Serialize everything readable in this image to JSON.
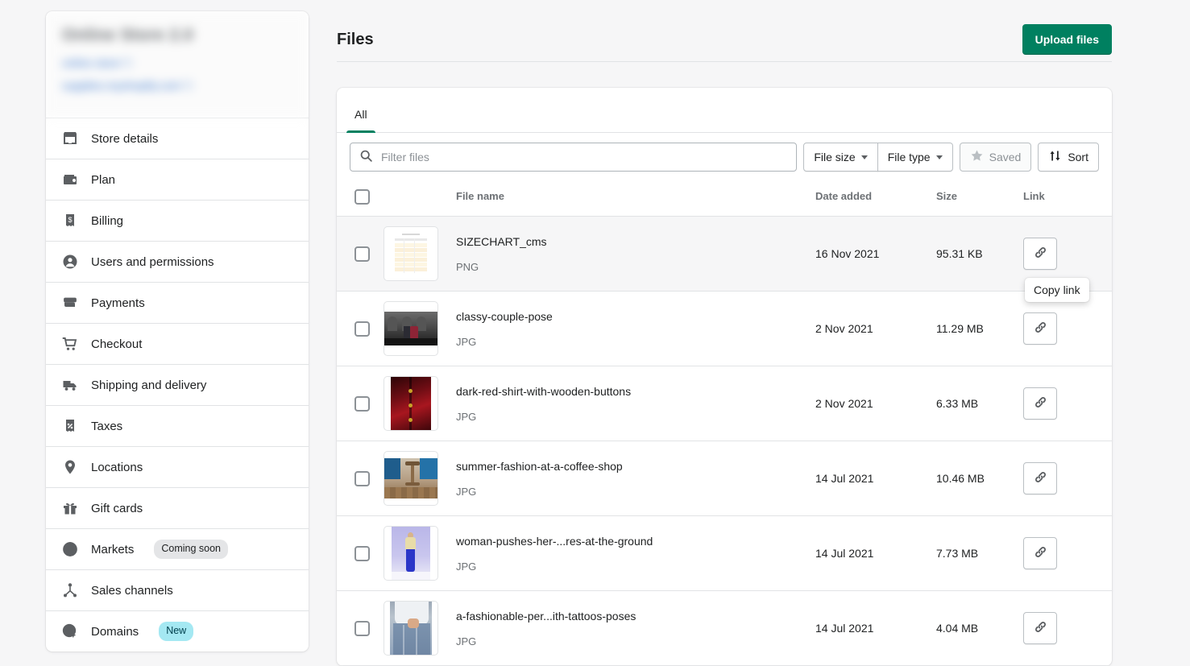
{
  "sidebar": {
    "store": {
      "name": "Online Store 2.0",
      "link_primary": "online store",
      "link_secondary": "supplies.myshopify.com"
    },
    "items": [
      {
        "label": "Store details",
        "icon": "storefront-icon",
        "badge": null
      },
      {
        "label": "Plan",
        "icon": "wallet-icon",
        "badge": null
      },
      {
        "label": "Billing",
        "icon": "receipt-dollar-icon",
        "badge": null
      },
      {
        "label": "Users and permissions",
        "icon": "person-circle-icon",
        "badge": null
      },
      {
        "label": "Payments",
        "icon": "credit-card-icon",
        "badge": null
      },
      {
        "label": "Checkout",
        "icon": "shopping-cart-icon",
        "badge": null
      },
      {
        "label": "Shipping and delivery",
        "icon": "delivery-truck-icon",
        "badge": null
      },
      {
        "label": "Taxes",
        "icon": "receipt-percent-icon",
        "badge": null
      },
      {
        "label": "Locations",
        "icon": "map-pin-icon",
        "badge": null
      },
      {
        "label": "Gift cards",
        "icon": "gift-icon",
        "badge": null
      },
      {
        "label": "Markets",
        "icon": "globe-icon",
        "badge": "Coming soon",
        "badge_style": "coming"
      },
      {
        "label": "Sales channels",
        "icon": "channels-icon",
        "badge": null
      },
      {
        "label": "Domains",
        "icon": "globe-cursor-icon",
        "badge": "New",
        "badge_style": "new"
      }
    ]
  },
  "header": {
    "title": "Files",
    "upload_label": "Upload files"
  },
  "tabs": [
    {
      "label": "All",
      "active": true
    }
  ],
  "filters": {
    "search_placeholder": "Filter files",
    "search_value": "",
    "file_size_label": "File size",
    "file_type_label": "File type",
    "saved_label": "Saved",
    "sort_label": "Sort"
  },
  "table": {
    "columns": [
      "File name",
      "Date added",
      "Size",
      "Link"
    ],
    "rows": [
      {
        "name": "SIZECHART_cms",
        "type": "PNG",
        "date": "16 Nov 2021",
        "size": "95.31 KB",
        "hovered": true,
        "thumb": "sizechart",
        "thumb_w": 46,
        "thumb_h": 60
      },
      {
        "name": "classy-couple-pose",
        "type": "JPG",
        "date": "2 Nov 2021",
        "size": "11.29 MB",
        "hovered": false,
        "thumb": "couple",
        "thumb_w": 68,
        "thumb_h": 42
      },
      {
        "name": "dark-red-shirt-with-wooden-buttons",
        "type": "JPG",
        "date": "2 Nov 2021",
        "size": "6.33 MB",
        "hovered": false,
        "thumb": "redshirt",
        "thumb_w": 50,
        "thumb_h": 68
      },
      {
        "name": "summer-fashion-at-a-coffee-shop",
        "type": "JPG",
        "date": "14 Jul 2021",
        "size": "10.46 MB",
        "hovered": false,
        "thumb": "coffee",
        "thumb_w": 68,
        "thumb_h": 50
      },
      {
        "name": "woman-pushes-her-...res-at-the-ground",
        "type": "JPG",
        "date": "14 Jul 2021",
        "size": "7.73 MB",
        "hovered": false,
        "thumb": "woman",
        "thumb_w": 48,
        "thumb_h": 68
      },
      {
        "name": "a-fashionable-per...ith-tattoos-poses",
        "type": "JPG",
        "date": "14 Jul 2021",
        "size": "4.04 MB",
        "hovered": false,
        "thumb": "tattoo",
        "thumb_w": 52,
        "thumb_h": 68
      }
    ]
  },
  "tooltip": {
    "text": "Copy link"
  },
  "colors": {
    "brand_green": "#008060",
    "page_bg": "#f6f6f7",
    "border": "#e1e3e5",
    "badge_new_bg": "#a4e8f2",
    "badge_coming_bg": "#e4e5e7",
    "link_blue": "#2c6ecb"
  }
}
